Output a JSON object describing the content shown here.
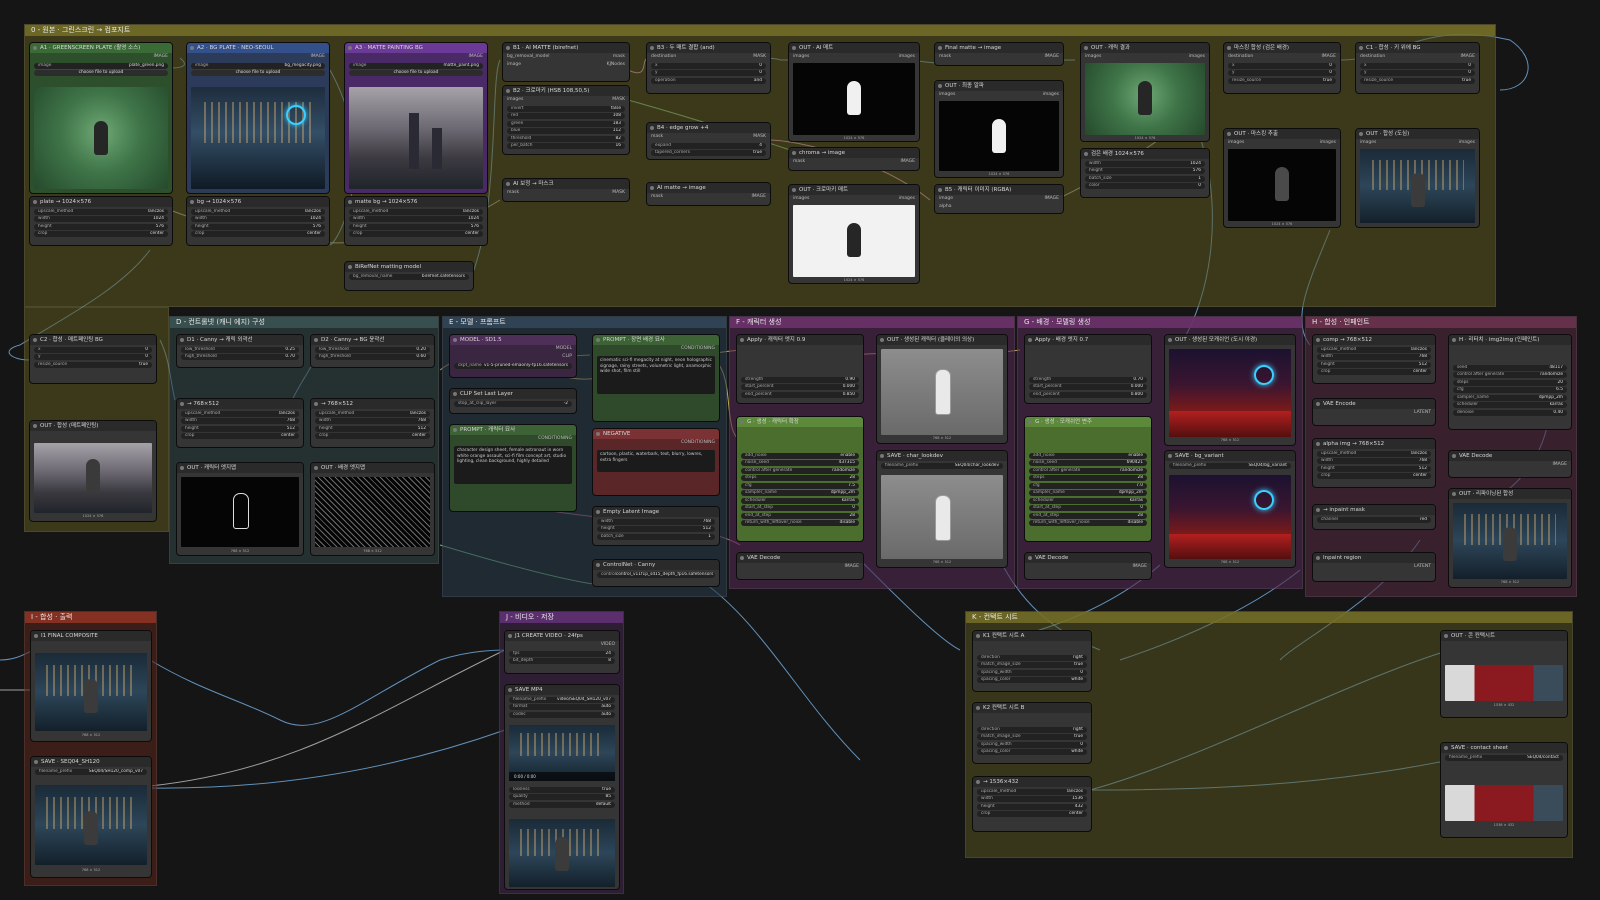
{
  "groups": {
    "input": "0 - 원본 · 그린스크린 → 컴포지트",
    "controlnet": "D - 컨트롤넷 (캐니 에지) 구성",
    "model": "E - 모델 · 프롬프트",
    "char_gen": "F - 캐릭터 생성",
    "bg_gen": "G - 배경 · 모델링 생성",
    "inpaint": "H - 합성 · 인페인트",
    "output": "I - 합성 · 출력",
    "video": "J - 비디오 · 저장",
    "contact": "K - 컨택트 시트"
  },
  "nodes": {
    "a1": {
      "title": "A1 · GREENSCREEN PLATE (촬영 소스)",
      "out1": "IMAGE",
      "out2": "MASK",
      "w1": "image",
      "v1": "plate_green.png",
      "btn": "choose file to upload"
    },
    "a2": {
      "title": "A2 · BG PLATE · NEO-SEOUL",
      "out1": "IMAGE",
      "out2": "MASK",
      "w1": "image",
      "v1": "bg_megacity.png",
      "btn": "choose file to upload"
    },
    "a3": {
      "title": "A3 · MATTE PAINTING BG",
      "out1": "IMAGE",
      "out2": "MASK",
      "w1": "image",
      "v1": "matte_paint.png",
      "btn": "choose file to upload"
    },
    "b1": {
      "title": "B1 · AI MATTE (birefnet)",
      "in1": "bg_removal_model",
      "in2": "image",
      "out": "mask",
      "badge": "KJNodes"
    },
    "b2": {
      "title": "B2 · 크로마키 (HSB 108,50,5)",
      "in1": "images",
      "out": "MASK",
      "rows": [
        [
          "invert",
          "false"
        ],
        [
          "red",
          "108"
        ],
        [
          "green",
          "183"
        ],
        [
          "blue",
          "112"
        ],
        [
          "threshold",
          "82"
        ],
        [
          "per_batch",
          "16"
        ]
      ]
    },
    "b3": {
      "title": "B3 · 두 매트 결합 (and)",
      "in1": "destination",
      "in2": "source",
      "out": "MASK",
      "rows": [
        [
          "x",
          "0"
        ],
        [
          "y",
          "0"
        ],
        [
          "operation",
          "and"
        ]
      ]
    },
    "b4": {
      "title": "B4 · edge grow +4",
      "in1": "mask",
      "out": "MASK",
      "rows": [
        [
          "expand",
          "4"
        ],
        [
          "tapered_corners",
          "true"
        ]
      ]
    },
    "b5": {
      "title": "AI matte → image",
      "in1": "mask",
      "out": "IMAGE"
    },
    "bmask": {
      "title": "AI 보정 → 마스크",
      "in1": "mask",
      "out": "MASK"
    },
    "birefnet": {
      "title": "BiRefNet matting model",
      "out": "bg_model",
      "w": "bg_removal_name",
      "v": "birefnet.safetensors"
    },
    "out_ai": {
      "title": "OUT · AI 매트",
      "in1": "images",
      "out": "images",
      "cap": "1024 × 576"
    },
    "chroma_img": {
      "title": "chroma → image",
      "in1": "mask",
      "out": "IMAGE"
    },
    "out_chroma": {
      "title": "OUT · 크로마키 매트",
      "in1": "images",
      "out": "images",
      "cap": "1024 × 576"
    },
    "final_matte": {
      "title": "Final matte → image",
      "in1": "mask",
      "out": "IMAGE"
    },
    "out_final": {
      "title": "OUT · 최종 알파",
      "in1": "images",
      "out": "images",
      "cap": "1024 × 576"
    },
    "b6": {
      "title": "B5 · 캐릭터 이미지 (RGBA)",
      "in1": "image",
      "in2": "alpha",
      "out": "IMAGE"
    },
    "out_char": {
      "title": "OUT · 캐릭 결과",
      "in1": "images",
      "out": "images",
      "cap": "1024 × 576"
    },
    "blank": {
      "title": "검은 배경 1024×576",
      "out": "IMAGE",
      "rows": [
        [
          "width",
          "1024"
        ],
        [
          "height",
          "576"
        ],
        [
          "batch_size",
          "1"
        ],
        [
          "color",
          "0"
        ]
      ]
    },
    "paste1": {
      "title": "마스킹 합성 (검은 배경)",
      "in1": "destination",
      "in2": "source",
      "in3": "mask",
      "out": "IMAGE",
      "rows": [
        [
          "x",
          "0"
        ],
        [
          "y",
          "0"
        ],
        [
          "resize_source",
          "true"
        ]
      ]
    },
    "out_mask": {
      "title": "OUT · 마스킹 추출",
      "in1": "images",
      "out": "images",
      "cap": "1024 × 576"
    },
    "c1": {
      "title": "C1 · 합성 · 키 위에 BG",
      "in1": "destination",
      "in2": "source",
      "in3": "mask",
      "out": "IMAGE",
      "rows": [
        [
          "x",
          "0"
        ],
        [
          "y",
          "0"
        ],
        [
          "resize_source",
          "true"
        ]
      ]
    },
    "out_c1": {
      "title": "OUT · 합성 (도심)",
      "in1": "images",
      "out": "images"
    },
    "up_plate": {
      "title": "plate → 1024×576",
      "rows": [
        [
          "upscale_method",
          "lanczos"
        ],
        [
          "width",
          "1024"
        ],
        [
          "height",
          "576"
        ],
        [
          "crop",
          "center"
        ]
      ]
    },
    "up_bg": {
      "title": "bg → 1024×576",
      "rows": [
        [
          "upscale_method",
          "lanczos"
        ],
        [
          "width",
          "1024"
        ],
        [
          "height",
          "576"
        ],
        [
          "crop",
          "center"
        ]
      ]
    },
    "up_matte": {
      "title": "matte bg → 1024×576",
      "rows": [
        [
          "upscale_method",
          "lanczos"
        ],
        [
          "width",
          "1024"
        ],
        [
          "height",
          "576"
        ],
        [
          "crop",
          "center"
        ]
      ]
    },
    "c2": {
      "title": "C2 · 합성 · 매트페인팅 BG",
      "rows": [
        [
          "x",
          "0"
        ],
        [
          "y",
          "0"
        ],
        [
          "resize_source",
          "true"
        ]
      ]
    },
    "out_c2": {
      "title": "OUT · 합성 (매트페인팅)",
      "cap": "1024 × 576"
    },
    "d1": {
      "title": "D1 · Canny → 캐릭 외곽선",
      "rows": [
        [
          "low_threshold",
          "0.25"
        ],
        [
          "high_threshold",
          "0.70"
        ]
      ]
    },
    "d2": {
      "title": "D2 · Canny → BG 윤곽선",
      "rows": [
        [
          "low_threshold",
          "0.20"
        ],
        [
          "high_threshold",
          "0.60"
        ]
      ]
    },
    "r768a": {
      "title": "→ 768×512",
      "rows": [
        [
          "upscale_method",
          "lanczos"
        ],
        [
          "width",
          "768"
        ],
        [
          "height",
          "512"
        ],
        [
          "crop",
          "center"
        ]
      ]
    },
    "r768b": {
      "title": "→ 768×512",
      "rows": [
        [
          "upscale_method",
          "lanczos"
        ],
        [
          "width",
          "768"
        ],
        [
          "height",
          "512"
        ],
        [
          "crop",
          "center"
        ]
      ]
    },
    "out_d1": {
      "title": "OUT · 캐릭터 엣지맵",
      "cap": "768 × 512"
    },
    "out_d2": {
      "title": "OUT · 배경 엣지맵",
      "cap": "768 × 512"
    },
    "model": {
      "title": "MODEL · SD1.5",
      "o1": "MODEL",
      "o2": "CLIP",
      "o3": "VAE",
      "w": "ckpt_name",
      "v": "v1-5-pruned-emaonly-fp16.safetensors"
    },
    "clipskip": {
      "title": "CLIP Set Last Layer",
      "w": "stop_at_clip_layer",
      "v": "-2"
    },
    "prompt_char": {
      "title": "PROMPT · 캐릭터 묘사",
      "out": "CONDITIONING",
      "text": "character design sheet, female astronaut in worn white orange assault, sci-fi film concept art, studio lighting, clean background, highly detailed"
    },
    "prompt_bg": {
      "title": "PROMPT · 장면 배경 묘사",
      "out": "CONDITIONING",
      "text": "cinematic sci-fi megacity at night, neon holographic signage, rainy streets, volumetric light, anamorphic wide shot, film still"
    },
    "negative": {
      "title": "NEGATIVE",
      "out": "CONDITIONING",
      "text": "cartoon, plastic, waterbark, text, blurry, lowres, extra fingers"
    },
    "latent": {
      "title": "Empty Latent Image",
      "out": "LATENT",
      "rows": [
        [
          "width",
          "768"
        ],
        [
          "height",
          "512"
        ],
        [
          "batch_size",
          "1"
        ]
      ]
    },
    "cnet_load": {
      "title": "ControlNet · Canny",
      "out": "CONTROL_NET",
      "w": "control",
      "v": "control_v11f1p_sd15_depth_fp16.safetensors"
    },
    "apply_char": {
      "title": "Apply · 캐릭터 엣지 0.9",
      "rows": [
        [
          "strength",
          "0.90"
        ],
        [
          "start_percent",
          "0.000"
        ],
        [
          "end_percent",
          "0.850"
        ]
      ]
    },
    "ks_char": {
      "title": "G · 생성 · 캐릭터 확장",
      "rows": [
        [
          "add_noise",
          "enable"
        ],
        [
          "noise_seed",
          "437315"
        ],
        [
          "control after generate",
          "randomize"
        ],
        [
          "steps",
          "28"
        ],
        [
          "cfg",
          "7.5"
        ],
        [
          "sampler_name",
          "dpmpp_2m"
        ],
        [
          "scheduler",
          "karras"
        ],
        [
          "start_at_step",
          "0"
        ],
        [
          "end_at_step",
          "28"
        ],
        [
          "return_with_leftover_noise",
          "disable"
        ]
      ]
    },
    "vae_char": {
      "title": "VAE Decode",
      "out": "IMAGE"
    },
    "out_gen_char": {
      "title": "OUT · 생성된 캐릭터 (클레이의 의상)",
      "cap": "768 × 512"
    },
    "save_char": {
      "title": "SAVE · char_lookdev",
      "w": "filename_prefix",
      "v": "SEQ04/char_lookdev",
      "cap": "768 × 512"
    },
    "apply_bg": {
      "title": "Apply · 배경 엣지 0.7",
      "rows": [
        [
          "strength",
          "0.70"
        ],
        [
          "start_percent",
          "0.000"
        ],
        [
          "end_percent",
          "0.800"
        ]
      ]
    },
    "ks_bg": {
      "title": "G · 생성 · 모캐쉬언 변주",
      "rows": [
        [
          "add_noise",
          "enable"
        ],
        [
          "noise_seed",
          "690421"
        ],
        [
          "control after generate",
          "randomize"
        ],
        [
          "steps",
          "28"
        ],
        [
          "cfg",
          "7.0"
        ],
        [
          "sampler_name",
          "dpmpp_2m"
        ],
        [
          "scheduler",
          "karras"
        ],
        [
          "start_at_step",
          "0"
        ],
        [
          "end_at_step",
          "28"
        ],
        [
          "return_with_leftover_noise",
          "disable"
        ]
      ]
    },
    "vae_bg": {
      "title": "VAE Decode",
      "out": "IMAGE"
    },
    "out_gen_bg": {
      "title": "OUT · 생성된 모캐쉬언 (도시 야경)",
      "cap": "768 × 512"
    },
    "save_bg": {
      "title": "SAVE · bg_variant",
      "w": "filename_prefix",
      "v": "SEQ04/bg_variant",
      "cap": "768 × 512"
    },
    "comp768": {
      "title": "comp → 768×512",
      "rows": [
        [
          "upscale_method",
          "lanczos"
        ],
        [
          "width",
          "768"
        ],
        [
          "height",
          "512"
        ],
        [
          "crop",
          "center"
        ]
      ]
    },
    "vae_enc": {
      "title": "VAE Encode",
      "out": "LATENT"
    },
    "alpha768": {
      "title": "alpha img → 768×512",
      "rows": [
        [
          "upscale_method",
          "lanczos"
        ],
        [
          "width",
          "768"
        ],
        [
          "height",
          "512"
        ],
        [
          "crop",
          "center"
        ]
      ]
    },
    "inpaint_mask": {
      "title": "→ inpaint mask",
      "rows": [
        [
          "channel",
          "red"
        ]
      ]
    },
    "inpaint_region": {
      "title": "Inpaint region",
      "out": "LATENT"
    },
    "ks_inpaint": {
      "title": "H · 리터치 · img2img (인페인트)",
      "rows": [
        [
          "seed",
          "48117"
        ],
        [
          "control after generate",
          "randomize"
        ],
        [
          "steps",
          "20"
        ],
        [
          "cfg",
          "6.5"
        ],
        [
          "sampler_name",
          "dpmpp_2m"
        ],
        [
          "scheduler",
          "karras"
        ],
        [
          "denoise",
          "0.40"
        ]
      ]
    },
    "vae_inp": {
      "title": "VAE Decode",
      "out": "IMAGE"
    },
    "out_inp": {
      "title": "OUT · 리파이닝된 합성",
      "cap": "768 × 512"
    },
    "final": {
      "title": "I1 FINAL COMPOSITE",
      "cap": "768 × 512"
    },
    "save_comp": {
      "title": "SAVE · SEQ04_SH120",
      "w": "filename_prefix",
      "v": "SEQ04/SH120_comp_v07",
      "cap": "768 × 512"
    },
    "video": {
      "title": "J1 CREATE VIDEO · 24fps",
      "out": "VIDEO",
      "rows": [
        [
          "fps",
          "24"
        ],
        [
          "bit_depth",
          "8"
        ]
      ]
    },
    "savevid": {
      "title": "SAVE MP4",
      "rows": [
        [
          "filename_prefix",
          "video/SEQ04_SH120_v07"
        ],
        [
          "format",
          "auto"
        ],
        [
          "codec",
          "auto"
        ]
      ],
      "time": "0:00 / 0:00"
    },
    "vidopts": {
      "rows": [
        [
          "lossless",
          "true"
        ],
        [
          "quality",
          "85"
        ],
        [
          "method",
          "default"
        ]
      ]
    },
    "concatA": {
      "title": "K1 컨택트 시트 A",
      "rows": [
        [
          "direction",
          "right"
        ],
        [
          "match_image_size",
          "true"
        ],
        [
          "spacing_width",
          "0"
        ],
        [
          "spacing_color",
          "white"
        ]
      ]
    },
    "concatB": {
      "title": "K2 컨택트 시트 B",
      "rows": [
        [
          "direction",
          "right"
        ],
        [
          "match_image_size",
          "true"
        ],
        [
          "spacing_width",
          "0"
        ],
        [
          "spacing_color",
          "white"
        ]
      ]
    },
    "r1536": {
      "title": "→ 1536×432",
      "rows": [
        [
          "upscale_method",
          "lanczos"
        ],
        [
          "width",
          "1536"
        ],
        [
          "height",
          "432"
        ],
        [
          "crop",
          "center"
        ]
      ]
    },
    "out_contact": {
      "title": "OUT · 콘 컨택시트",
      "cap": "1536 × 432"
    },
    "save_contact": {
      "title": "SAVE · contact sheet",
      "w": "filename_prefix",
      "v": "SEQ04/contact",
      "cap": "1536 × 432"
    }
  },
  "colors": {
    "yellow_group": "#4d4a1c",
    "green_node": "#2e4f2c",
    "blue_node": "#2c3b5a",
    "purple_node": "#4a2a66",
    "model_node": "#3a2640",
    "prompt_node": "#2f4a2a",
    "neg_node": "#5a2628",
    "ks_green": "#5d8a3a"
  }
}
